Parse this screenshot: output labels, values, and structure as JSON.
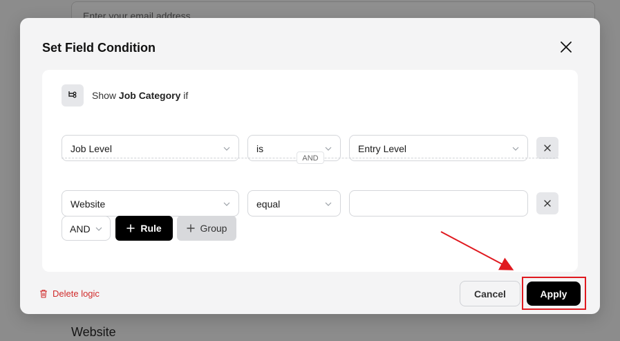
{
  "background": {
    "email_placeholder": "Enter your email address",
    "field_label": "Website"
  },
  "modal": {
    "title": "Set Field Condition",
    "condition": {
      "prefix": "Show",
      "field": "Job Category",
      "suffix": "if"
    },
    "rules": [
      {
        "field": "Job Level",
        "operator": "is",
        "value": "Entry Level"
      },
      {
        "field": "Website",
        "operator": "equal",
        "value": ""
      }
    ],
    "rule_separator": "AND",
    "logic_select": "AND",
    "add_rule_label": "Rule",
    "add_group_label": "Group",
    "delete_logic_label": "Delete logic",
    "cancel_label": "Cancel",
    "apply_label": "Apply"
  },
  "colors": {
    "accent": "#000000",
    "danger": "#d02a2a",
    "annotation": "#e0191f"
  },
  "icons": [
    "close-icon",
    "condition-branch-icon",
    "chevron-down-icon",
    "remove-icon",
    "plus-icon",
    "trash-icon",
    "arrow-annotation"
  ]
}
